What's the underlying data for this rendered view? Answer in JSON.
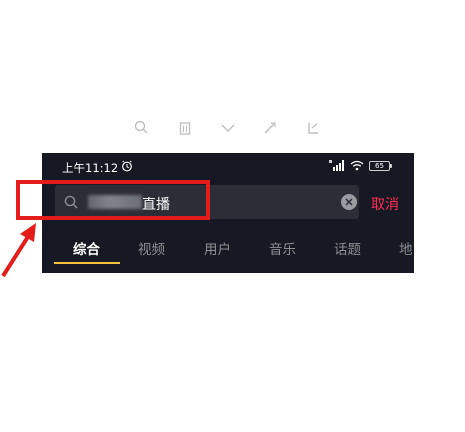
{
  "status_bar": {
    "time": "上午11:12",
    "battery": "65"
  },
  "search": {
    "query": "直播"
  },
  "cancel_label": "取消",
  "tabs": [
    {
      "label": "综合",
      "active": true
    },
    {
      "label": "视频",
      "active": false
    },
    {
      "label": "用户",
      "active": false
    },
    {
      "label": "音乐",
      "active": false
    },
    {
      "label": "话题",
      "active": false
    },
    {
      "label": "地",
      "active": false
    }
  ],
  "colors": {
    "panel_bg": "#161823",
    "search_bg": "#2b2d37",
    "accent_red": "#fe2c55",
    "tab_underline": "#f2c33b",
    "annotation_red": "#e41c1c"
  },
  "icons": [
    "search-icon",
    "clear-icon",
    "alarm-icon",
    "signal-icon",
    "wifi-icon",
    "battery-icon",
    "annotation-arrow"
  ]
}
